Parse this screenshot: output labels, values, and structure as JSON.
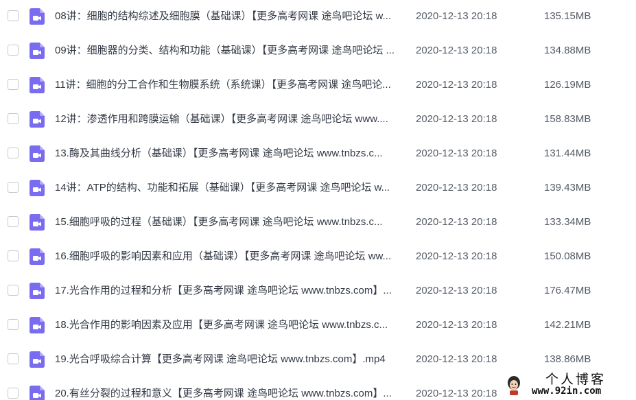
{
  "files": [
    {
      "name": "08讲：细胞的结构综述及细胞膜（基础课）【更多高考网课 途鸟吧论坛 w...",
      "date": "2020-12-13 20:18",
      "size": "135.15MB"
    },
    {
      "name": "09讲：细胞器的分类、结构和功能（基础课）【更多高考网课 途鸟吧论坛 ...",
      "date": "2020-12-13 20:18",
      "size": "134.88MB"
    },
    {
      "name": "11讲：细胞的分工合作和生物膜系统（系统课）【更多高考网课 途鸟吧论...",
      "date": "2020-12-13 20:18",
      "size": "126.19MB"
    },
    {
      "name": "12讲：渗透作用和跨膜运输（基础课）【更多高考网课 途鸟吧论坛 www....",
      "date": "2020-12-13 20:18",
      "size": "158.83MB"
    },
    {
      "name": "13.酶及其曲线分析（基础课）【更多高考网课 途鸟吧论坛 www.tnbzs.c...",
      "date": "2020-12-13 20:18",
      "size": "131.44MB"
    },
    {
      "name": "14讲：ATP的结构、功能和拓展（基础课）【更多高考网课 途鸟吧论坛 w...",
      "date": "2020-12-13 20:18",
      "size": "139.43MB"
    },
    {
      "name": "15.细胞呼吸的过程（基础课）【更多高考网课 途鸟吧论坛 www.tnbzs.c...",
      "date": "2020-12-13 20:18",
      "size": "133.34MB"
    },
    {
      "name": "16.细胞呼吸的影响因素和应用（基础课）【更多高考网课 途鸟吧论坛 ww...",
      "date": "2020-12-13 20:18",
      "size": "150.08MB"
    },
    {
      "name": "17.光合作用的过程和分析【更多高考网课 途鸟吧论坛 www.tnbzs.com】...",
      "date": "2020-12-13 20:18",
      "size": "176.47MB"
    },
    {
      "name": "18.光合作用的影响因素及应用【更多高考网课 途鸟吧论坛 www.tnbzs.c...",
      "date": "2020-12-13 20:18",
      "size": "142.21MB"
    },
    {
      "name": "19.光合呼吸综合计算【更多高考网课 途鸟吧论坛 www.tnbzs.com】.mp4",
      "date": "2020-12-13 20:18",
      "size": "138.86MB"
    },
    {
      "name": "20.有丝分裂的过程和意义【更多高考网课 途鸟吧论坛 www.tnbzs.com】...",
      "date": "2020-12-13 20:18",
      "size": ""
    }
  ],
  "icons": {
    "file_type": "video-file-icon",
    "accent": "#7a6cf0"
  },
  "watermark": {
    "title": "个人博客",
    "url": "www.92in.com"
  }
}
